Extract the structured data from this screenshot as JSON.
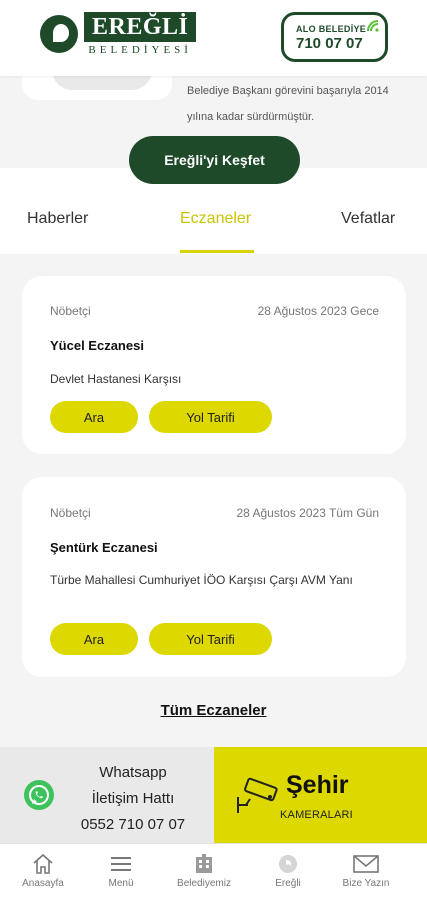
{
  "header": {
    "logo_name": "EREĞLİ",
    "logo_sub": "BELEDİYESİ",
    "alo_label": "ALO BELEDİYE",
    "alo_number": "710 07 07"
  },
  "about": {
    "text_line1": "Belediye Başkanı görevini başarıyla 2014",
    "text_line2": "yılına kadar sürdürmüştür.",
    "explore_label": "Ereğli'yi Keşfet"
  },
  "tabs": [
    {
      "label": "Haberler",
      "active": false
    },
    {
      "label": "Eczaneler",
      "active": true
    },
    {
      "label": "Vefatlar",
      "active": false
    }
  ],
  "pharmacies": [
    {
      "type": "Nöbetçi",
      "date": "28 Ağustos 2023 Gece",
      "name": "Yücel Eczanesi",
      "address": "Devlet Hastanesi Karşısı",
      "call_label": "Ara",
      "directions_label": "Yol Tarifi"
    },
    {
      "type": "Nöbetçi",
      "date": "28 Ağustos 2023 Tüm Gün",
      "name": "Şentürk Eczanesi",
      "address": "Türbe Mahallesi Cumhuriyet İÖO Karşısı Çarşı AVM Yanı",
      "call_label": "Ara",
      "directions_label": "Yol Tarifi"
    }
  ],
  "all_pharmacies_label": "Tüm Eczaneler",
  "whatsapp": {
    "line1": "Whatsapp",
    "line2": "İletişim Hattı",
    "line3": "0552 710 07 07"
  },
  "camera": {
    "title": "Şehir",
    "subtitle": "KAMERALARI"
  },
  "bottom_nav": [
    {
      "label": "Anasayfa",
      "icon": "home-icon"
    },
    {
      "label": "Menü",
      "icon": "menu-icon"
    },
    {
      "label": "Belediyemiz",
      "icon": "building-icon"
    },
    {
      "label": "Ereğli",
      "icon": "city-logo-icon"
    },
    {
      "label": "Bize Yazın",
      "icon": "mail-icon"
    }
  ],
  "colors": {
    "brand_green": "#1e4a2a",
    "accent_yellow": "#dcd800",
    "whatsapp_green": "#3ec35c"
  }
}
